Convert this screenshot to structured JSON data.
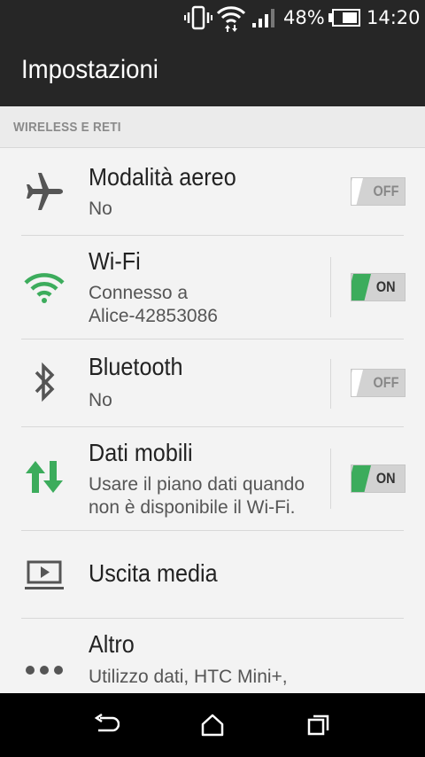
{
  "status_bar": {
    "battery_percent": "48%",
    "time": "14:20"
  },
  "app_bar": {
    "title": "Impostazioni"
  },
  "section": {
    "header": "WIRELESS E RETI"
  },
  "items": [
    {
      "title": "Modalità aereo",
      "summary": [
        "No"
      ],
      "toggle": "OFF",
      "icon": "airplane-icon"
    },
    {
      "title": "Wi-Fi",
      "summary": [
        "Connesso a",
        "Alice-42853086"
      ],
      "toggle": "ON",
      "icon": "wifi-icon"
    },
    {
      "title": "Bluetooth",
      "summary": [
        "No"
      ],
      "toggle": "OFF",
      "icon": "bluetooth-icon"
    },
    {
      "title": "Dati mobili",
      "summary": [
        "Usare il piano dati quando",
        "non è disponibile il Wi-Fi."
      ],
      "toggle": "ON",
      "icon": "mobile-data-icon"
    },
    {
      "title": "Uscita media",
      "summary": [],
      "icon": "media-output-icon"
    },
    {
      "title": "Altro",
      "summary": [
        "Utilizzo dati, HTC Mini+,"
      ],
      "icon": "more-icon"
    }
  ],
  "colors": {
    "accent_green": "#3cac5c",
    "toggle_off_stripe": "#ffffff",
    "bar_background": "#262626"
  },
  "nav_bar": {
    "icons": [
      "back-icon",
      "home-icon",
      "recent-apps-icon"
    ]
  }
}
